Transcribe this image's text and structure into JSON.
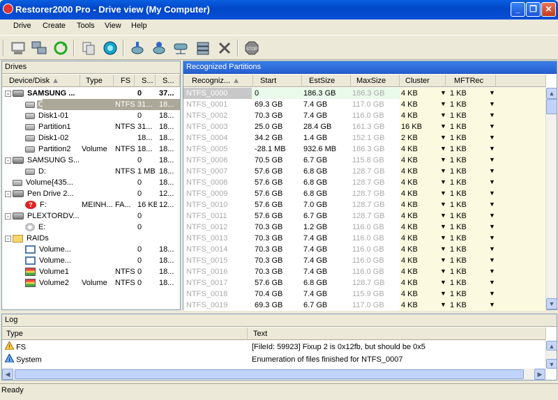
{
  "window": {
    "title": "Restorer2000 Pro - Drive view (My Computer)",
    "min": "_",
    "max": "❐",
    "close": "✕"
  },
  "menu": [
    "Drive",
    "Create",
    "Tools",
    "View",
    "Help"
  ],
  "toolbar_icons": [
    "computer-icon",
    "network-icon",
    "refresh-icon",
    "copy-icon",
    "scan-icon",
    "disk-add-icon",
    "disk-open-icon",
    "network-drive-icon",
    "raid-icon",
    "remove-icon",
    "stop-icon"
  ],
  "drives": {
    "title": "Drives",
    "columns": [
      "Device/Disk",
      "Type",
      "FS",
      "S...",
      "S..."
    ],
    "rows": [
      {
        "name": "SAMSUNG ...",
        "type": "",
        "fs": "",
        "s1": "0",
        "s2": "37...",
        "level": 0,
        "bold": true,
        "icon": "disk",
        "pm": "-"
      },
      {
        "name": "C:",
        "type": "",
        "fs": "NTFS",
        "s1": "31...",
        "s2": "18...",
        "level": 1,
        "selected": true,
        "icon": "part"
      },
      {
        "name": "Disk1-01",
        "type": "",
        "fs": "",
        "s1": "0",
        "s2": "18...",
        "level": 1,
        "icon": "part"
      },
      {
        "name": "Partition1",
        "type": "",
        "fs": "NTFS",
        "s1": "31...",
        "s2": "18...",
        "level": 1,
        "icon": "part"
      },
      {
        "name": "Disk1-02",
        "type": "",
        "fs": "",
        "s1": "18...",
        "s2": "18...",
        "level": 1,
        "icon": "part"
      },
      {
        "name": "Partition2",
        "type": "Volume",
        "fs": "NTFS",
        "s1": "18...",
        "s2": "18...",
        "level": 1,
        "icon": "part"
      },
      {
        "name": "SAMSUNG S...",
        "type": "",
        "fs": "",
        "s1": "0",
        "s2": "18...",
        "level": 0,
        "icon": "disk",
        "pm": "-"
      },
      {
        "name": "D:",
        "type": "",
        "fs": "NTFS",
        "s1": "1 MB",
        "s2": "18...",
        "level": 1,
        "icon": "part"
      },
      {
        "name": "Volume{435...",
        "type": "",
        "fs": "",
        "s1": "0",
        "s2": "18...",
        "level": 0,
        "icon": "part"
      },
      {
        "name": "Pen Drive 2...",
        "type": "",
        "fs": "",
        "s1": "0",
        "s2": "12...",
        "level": 0,
        "icon": "disk",
        "pm": "-"
      },
      {
        "name": "F:",
        "type": "MEINH...",
        "fs": "FA...",
        "s1": "16 KB",
        "s2": "12...",
        "level": 1,
        "icon": "bad"
      },
      {
        "name": "PLEXTORDV...",
        "type": "",
        "fs": "",
        "s1": "0",
        "s2": "",
        "level": 0,
        "icon": "disk",
        "pm": "-"
      },
      {
        "name": "E:",
        "type": "",
        "fs": "",
        "s1": "0",
        "s2": "",
        "level": 1,
        "icon": "cd"
      },
      {
        "name": "RAIDs",
        "type": "",
        "fs": "",
        "s1": "",
        "s2": "",
        "level": 0,
        "icon": "folder",
        "pm": "-"
      },
      {
        "name": "Volume...",
        "type": "",
        "fs": "",
        "s1": "0",
        "s2": "18...",
        "level": 1,
        "icon": "raid"
      },
      {
        "name": "Volume...",
        "type": "",
        "fs": "",
        "s1": "0",
        "s2": "18...",
        "level": 1,
        "icon": "raid"
      },
      {
        "name": "Volume1",
        "type": "",
        "fs": "NTFS",
        "s1": "0",
        "s2": "18...",
        "level": 1,
        "icon": "raidc"
      },
      {
        "name": "Volume2",
        "type": "Volume",
        "fs": "NTFS",
        "s1": "0",
        "s2": "18...",
        "level": 1,
        "icon": "raidc"
      }
    ]
  },
  "partitions": {
    "title": "Recognized Partitions",
    "columns": [
      "Recogniz...",
      "Start",
      "EstSize",
      "MaxSize",
      "Cluster",
      "MFTRec"
    ],
    "rows": [
      [
        "NTFS_0000",
        "0",
        "186.3 GB",
        "186.3 GB",
        "4 KB",
        "1 KB"
      ],
      [
        "NTFS_0001",
        "69.3 GB",
        "7.4 GB",
        "117.0 GB",
        "4 KB",
        "1 KB"
      ],
      [
        "NTFS_0002",
        "70.3 GB",
        "7.4 GB",
        "116.0 GB",
        "4 KB",
        "1 KB"
      ],
      [
        "NTFS_0003",
        "25.0 GB",
        "28.4 GB",
        "161.3 GB",
        "16 KB",
        "1 KB"
      ],
      [
        "NTFS_0004",
        "34.2 GB",
        "1.4 GB",
        "152.1 GB",
        "2 KB",
        "1 KB"
      ],
      [
        "NTFS_0005",
        "-28.1 MB",
        "932.6 MB",
        "186.3 GB",
        "4 KB",
        "1 KB"
      ],
      [
        "NTFS_0006",
        "70.5 GB",
        "6.7 GB",
        "115.8 GB",
        "4 KB",
        "1 KB"
      ],
      [
        "NTFS_0007",
        "57.6 GB",
        "6.8 GB",
        "128.7 GB",
        "4 KB",
        "1 KB"
      ],
      [
        "NTFS_0008",
        "57.6 GB",
        "6.8 GB",
        "128.7 GB",
        "4 KB",
        "1 KB"
      ],
      [
        "NTFS_0009",
        "57.6 GB",
        "6.8 GB",
        "128.7 GB",
        "4 KB",
        "1 KB"
      ],
      [
        "NTFS_0010",
        "57.6 GB",
        "7.0 GB",
        "128.7 GB",
        "4 KB",
        "1 KB"
      ],
      [
        "NTFS_0011",
        "57.6 GB",
        "6.7 GB",
        "128.7 GB",
        "4 KB",
        "1 KB"
      ],
      [
        "NTFS_0012",
        "70.3 GB",
        "1.2 GB",
        "116.0 GB",
        "4 KB",
        "1 KB"
      ],
      [
        "NTFS_0013",
        "70.3 GB",
        "7.4 GB",
        "116.0 GB",
        "4 KB",
        "1 KB"
      ],
      [
        "NTFS_0014",
        "70.3 GB",
        "7.4 GB",
        "116.0 GB",
        "4 KB",
        "1 KB"
      ],
      [
        "NTFS_0015",
        "70.3 GB",
        "7.4 GB",
        "116.0 GB",
        "4 KB",
        "1 KB"
      ],
      [
        "NTFS_0016",
        "70.3 GB",
        "7.4 GB",
        "116.0 GB",
        "4 KB",
        "1 KB"
      ],
      [
        "NTFS_0017",
        "57.6 GB",
        "6.8 GB",
        "128.7 GB",
        "4 KB",
        "1 KB"
      ],
      [
        "NTFS_0018",
        "70.4 GB",
        "7.4 GB",
        "115.9 GB",
        "4 KB",
        "1 KB"
      ],
      [
        "NTFS_0019",
        "69.3 GB",
        "6.7 GB",
        "117.0 GB",
        "4 KB",
        "1 KB"
      ]
    ]
  },
  "log": {
    "title": "Log",
    "columns": [
      "Type",
      "Text"
    ],
    "rows": [
      {
        "type": "FS",
        "text": "[FileId: 59923] Fixup 2 is 0x12fb, but should be 0x5",
        "icon": "warning-icon"
      },
      {
        "type": "System",
        "text": "Enumeration of files finished for NTFS_0007",
        "icon": "info-icon"
      }
    ]
  },
  "status": "Ready"
}
